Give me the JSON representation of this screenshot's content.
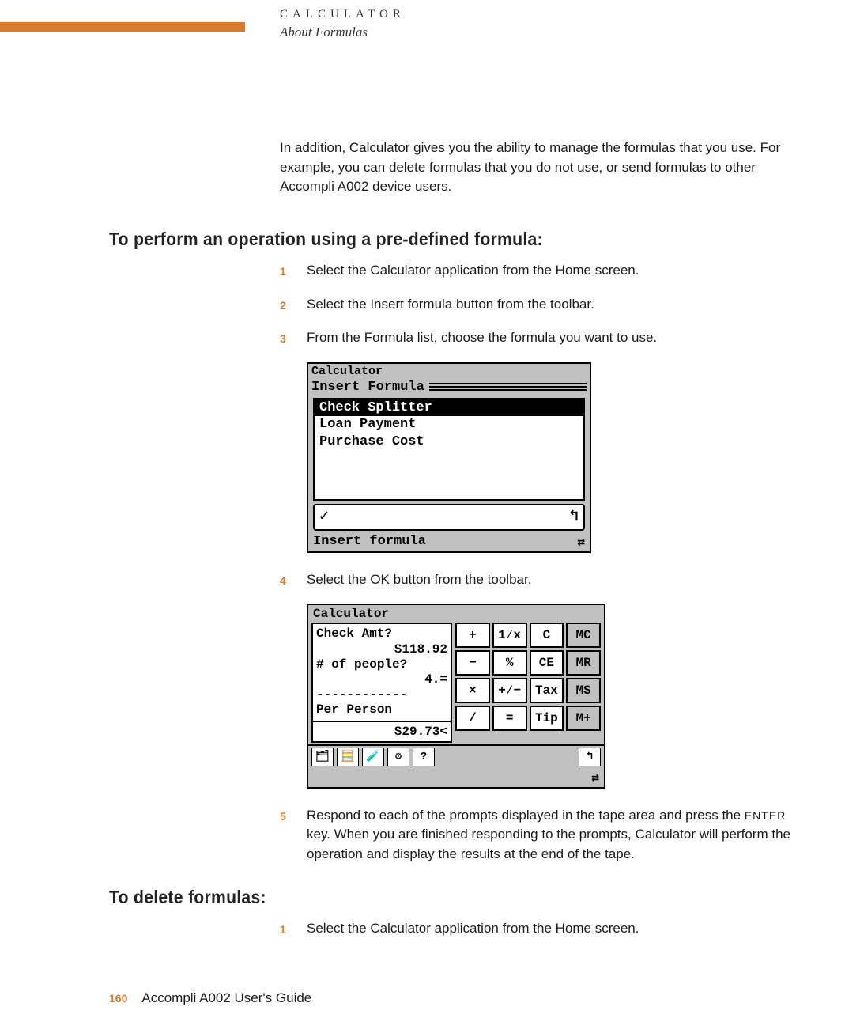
{
  "header": {
    "category": "CALCULATOR",
    "subtitle": "About Formulas"
  },
  "intro": "In addition, Calculator gives you the ability to manage the formulas that you use. For example, you can delete formulas that you do not use, or send formulas to other Accompli A002 device users.",
  "section1": {
    "heading": "To perform an operation using a pre-defined formula:",
    "steps": [
      {
        "num": "1",
        "text": "Select the Calculator application from the Home screen."
      },
      {
        "num": "2",
        "text": "Select the Insert formula button from the toolbar."
      },
      {
        "num": "3",
        "text": "From the Formula list, choose the formula you want to use."
      },
      {
        "num": "4",
        "text": "Select the OK button from the toolbar."
      },
      {
        "num": "5",
        "text_a": "Respond to each of the prompts displayed in the tape area and press the ",
        "key": "ENTER",
        "text_b": " key. When you are finished responding to the prompts, Calculator will perform the operation and display the results at the end of the tape."
      }
    ]
  },
  "fig1": {
    "app_word": "Calculator",
    "title": "Insert Formula",
    "options": [
      "Check Splitter",
      "Loan Payment",
      "Purchase Cost"
    ],
    "selected_index": 0,
    "ok_glyph": "✓",
    "back_glyph": "↰",
    "status": "Insert formula",
    "swap_glyph": "⇄"
  },
  "fig2": {
    "title": "Calculator",
    "tape": {
      "l1a": "Check Amt?",
      "l1b": "",
      "l2a": "",
      "l2b": "$118.92",
      "l3a": "# of people?",
      "l3b": "",
      "l4a": "",
      "l4b": "4.=",
      "l5": "------------",
      "l6a": "Per Person",
      "l6b": "",
      "result": "$29.73<"
    },
    "keys": {
      "r1c1": "+",
      "r1c2": "1⁄x",
      "r1c3": "C",
      "r1c4": "MC",
      "r2c1": "−",
      "r2c2": "%",
      "r2c3": "CE",
      "r2c4": "MR",
      "r3c1": "×",
      "r3c2": "+⁄−",
      "r3c3": "Tax",
      "r3c4": "MS",
      "r4c1": "/",
      "r4c2": "=",
      "r4c3": "Tip",
      "r4c4": "M+"
    },
    "icons": {
      "i1": "🗂",
      "i2": "🧮",
      "i3": "🧪",
      "i4": "⚙",
      "i5": "?",
      "back": "↰",
      "swap": "⇄"
    }
  },
  "section2": {
    "heading": "To delete formulas:",
    "steps": [
      {
        "num": "1",
        "text": "Select the Calculator application from the Home screen."
      }
    ]
  },
  "footer": {
    "page": "160",
    "guide": "Accompli A002 User's Guide"
  }
}
